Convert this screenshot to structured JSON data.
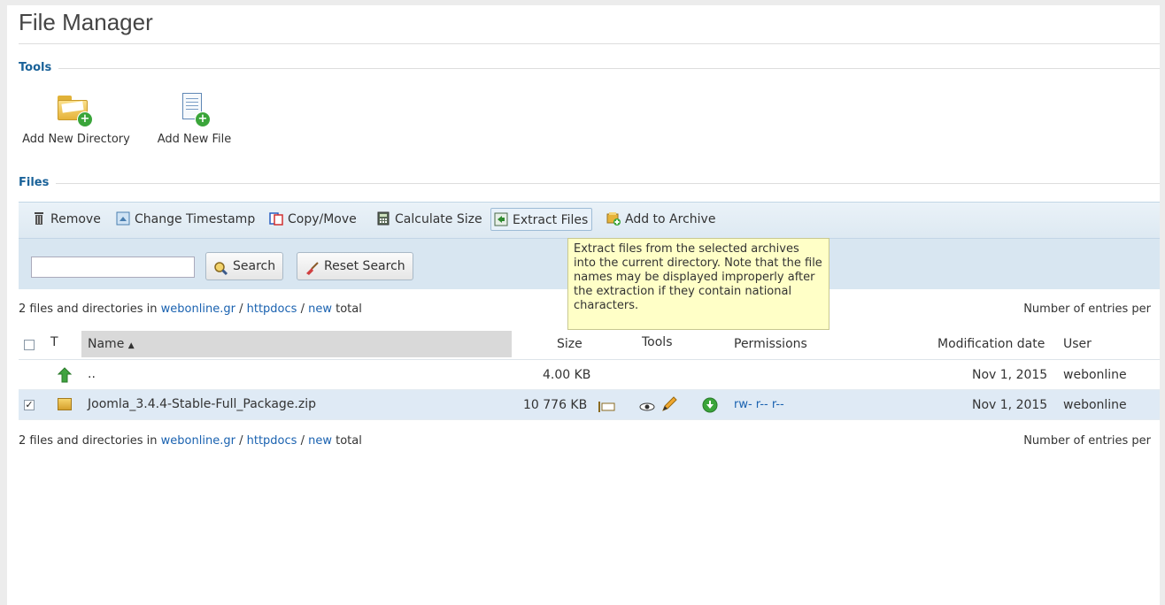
{
  "page": {
    "title": "File Manager"
  },
  "sections": {
    "tools": "Tools",
    "files": "Files"
  },
  "tools": {
    "add_dir": "Add New Directory",
    "add_file": "Add New File"
  },
  "actions": {
    "remove": "Remove",
    "change_timestamp": "Change Timestamp",
    "copy_move": "Copy/Move",
    "calculate_size": "Calculate Size",
    "extract_files": "Extract Files",
    "add_to_archive": "Add to Archive"
  },
  "search": {
    "value": "",
    "search_label": "Search",
    "reset_label": "Reset Search"
  },
  "tooltip": {
    "text": "Extract files from the selected archives into the current directory. Note that the file names may be displayed improperly after the extraction if they contain national characters."
  },
  "path": {
    "prefix": "2 files and directories in",
    "domain": "webonline.gr",
    "sep": "/",
    "folder1": "httpdocs",
    "folder2": "new",
    "suffix": "total",
    "entries_label": "Number of entries per"
  },
  "columns": {
    "type": "T",
    "name": "Name",
    "sort_arrow": "▲",
    "size": "Size",
    "tools": "Tools",
    "permissions": "Permissions",
    "modified": "Modification date",
    "user": "User"
  },
  "rows": [
    {
      "name": "..",
      "size": "4.00 KB",
      "perms": "",
      "date": "Nov 1, 2015",
      "user": "webonline",
      "checked": false
    },
    {
      "name": "Joomla_3.4.4-Stable-Full_Package.zip",
      "size": "10 776 KB",
      "perms": "rw- r-- r--",
      "date": "Nov 1, 2015",
      "user": "webonline",
      "checked": true
    }
  ],
  "colors": {
    "accent": "#1a6299",
    "toolbar": "#d8e6f1",
    "tooltip": "#ffffc7",
    "selected_row": "#dfeaf5"
  }
}
